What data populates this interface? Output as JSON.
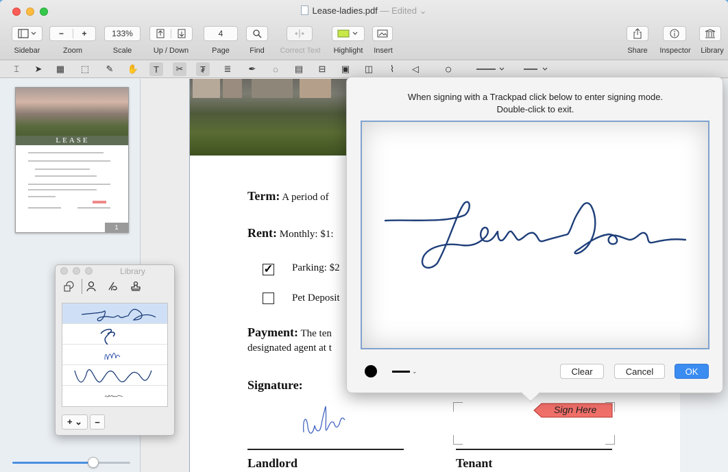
{
  "window": {
    "title": "Lease-ladies.pdf",
    "title_status": "— Edited ⌄"
  },
  "toolbar": {
    "zoom_value": "133%",
    "page_value": "4",
    "labels": {
      "sidebar": "Sidebar",
      "zoom": "Zoom",
      "scale": "Scale",
      "updown": "Up / Down",
      "page": "Page",
      "find": "Find",
      "correct_text": "Correct Text",
      "highlight": "Highlight",
      "insert": "Insert",
      "share": "Share",
      "inspector": "Inspector",
      "library": "Library"
    },
    "zoom_out": "−",
    "zoom_in": "+"
  },
  "library_panel": {
    "title": "Library",
    "add_label": "+ ⌄",
    "remove_label": "−"
  },
  "thumbnail": {
    "banner": "LEASE",
    "page_label": "1"
  },
  "document": {
    "term_label": "Term:",
    "term_text": "A period of",
    "rent_label": "Rent:",
    "rent_text": "Monthly: $1:",
    "parking_text": "Parking: $2",
    "parking_check": "✓",
    "pet_text": "Pet Deposit",
    "payment_label": "Payment:",
    "payment_text": "The ten",
    "payment_text2": "designated agent at t",
    "signature_label": "Signature:",
    "landlord": "Landlord",
    "tenant": "Tenant",
    "sign_here": "Sign Here"
  },
  "signature_popover": {
    "instruction_line1": "When signing with a Trackpad click below to enter signing mode.",
    "instruction_line2": "Double-click to exit.",
    "clear": "Clear",
    "cancel": "Cancel",
    "ok": "OK",
    "ink_color": "#1f3f7a"
  },
  "colors": {
    "accent": "#3b8cf1",
    "sign_here": "#f2706a"
  }
}
